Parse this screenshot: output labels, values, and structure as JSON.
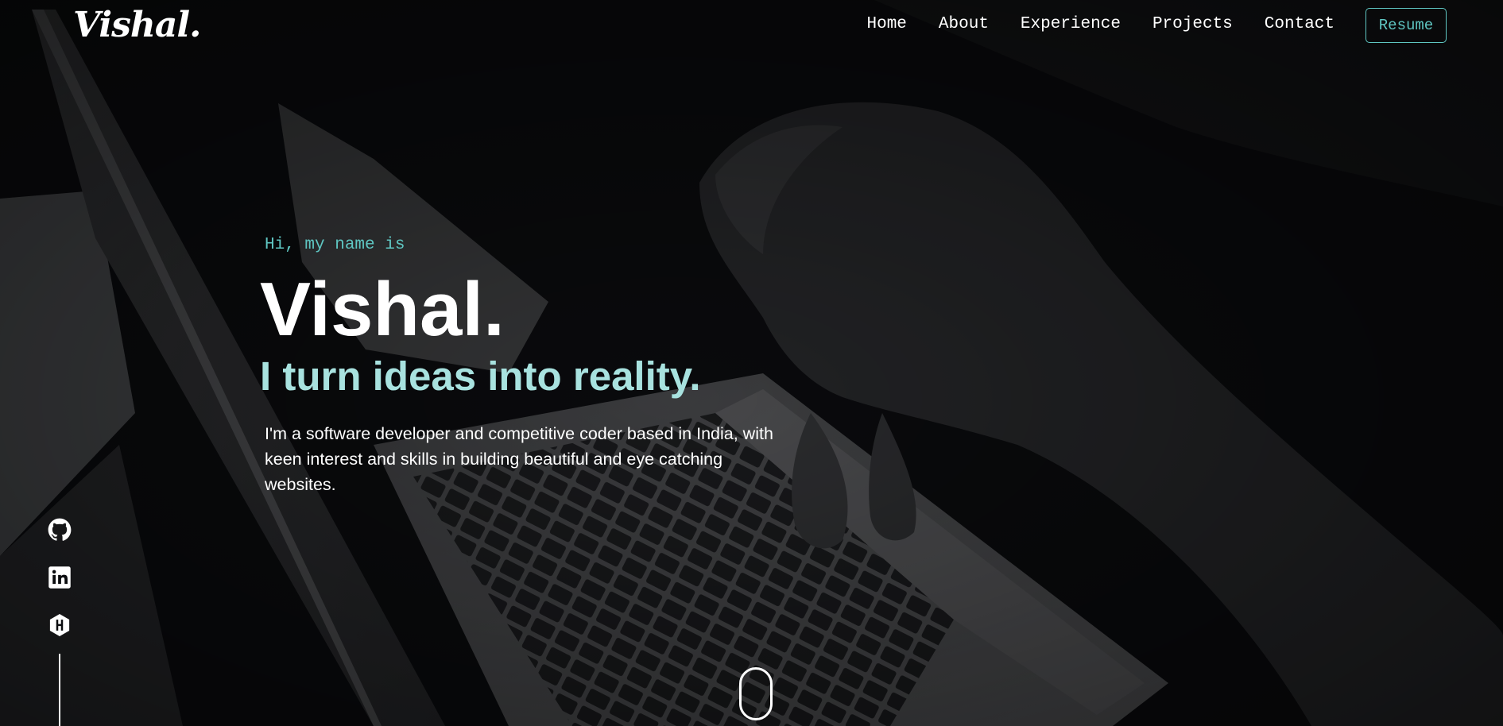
{
  "brand": {
    "logo_text": "Vishal.",
    "accent_color": "#5fc6c2",
    "tagline_color": "#a8e2df"
  },
  "nav": {
    "items": [
      {
        "label": "Home"
      },
      {
        "label": "About"
      },
      {
        "label": "Experience"
      },
      {
        "label": "Projects"
      },
      {
        "label": "Contact"
      }
    ],
    "resume_label": "Resume"
  },
  "hero": {
    "greeting": "Hi, my name is",
    "name": "Vishal.",
    "tagline": "I turn ideas into reality.",
    "description": "I'm a software developer and competitive coder based in India, with keen interest and skills in building beautiful and eye catching websites."
  },
  "socials": [
    {
      "icon": "github-icon"
    },
    {
      "icon": "linkedin-icon"
    },
    {
      "icon": "hashnode-icon"
    }
  ],
  "scroll_indicator": {
    "icon": "mouse-scroll-icon"
  }
}
